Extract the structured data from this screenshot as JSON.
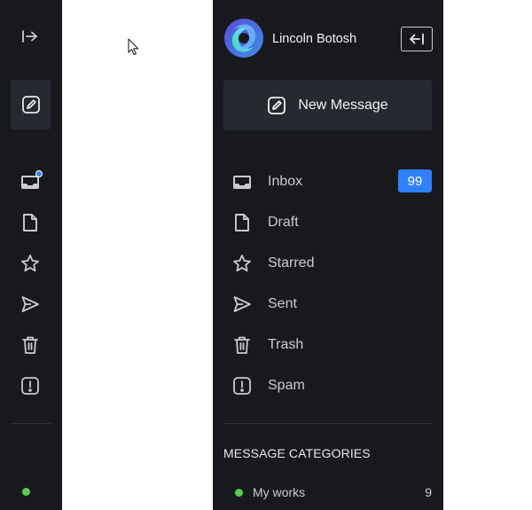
{
  "rail": {
    "icons": [
      "expand-icon",
      "compose-icon",
      "inbox-icon",
      "draft-icon",
      "star-icon",
      "send-icon",
      "trash-icon",
      "spam-icon"
    ],
    "status_color": "#5ecb53",
    "notification_color": "#2f80ff"
  },
  "user": {
    "name": "Lincoln Botosh"
  },
  "compose": {
    "label": "New Message"
  },
  "nav": {
    "items": [
      {
        "label": "Inbox",
        "icon": "inbox-icon",
        "badge": "99"
      },
      {
        "label": "Draft",
        "icon": "draft-icon"
      },
      {
        "label": "Starred",
        "icon": "star-icon"
      },
      {
        "label": "Sent",
        "icon": "send-icon"
      },
      {
        "label": "Trash",
        "icon": "trash-icon"
      },
      {
        "label": "Spam",
        "icon": "spam-icon"
      }
    ]
  },
  "categories": {
    "heading": "MESSAGE CATEGORIES",
    "items": [
      {
        "label": "My works",
        "count": "9",
        "color": "#5ecb53"
      }
    ]
  },
  "colors": {
    "sidebar_bg": "#18191d",
    "button_bg": "#272930",
    "accent": "#2f80ff",
    "text": "#c9cbd1"
  }
}
